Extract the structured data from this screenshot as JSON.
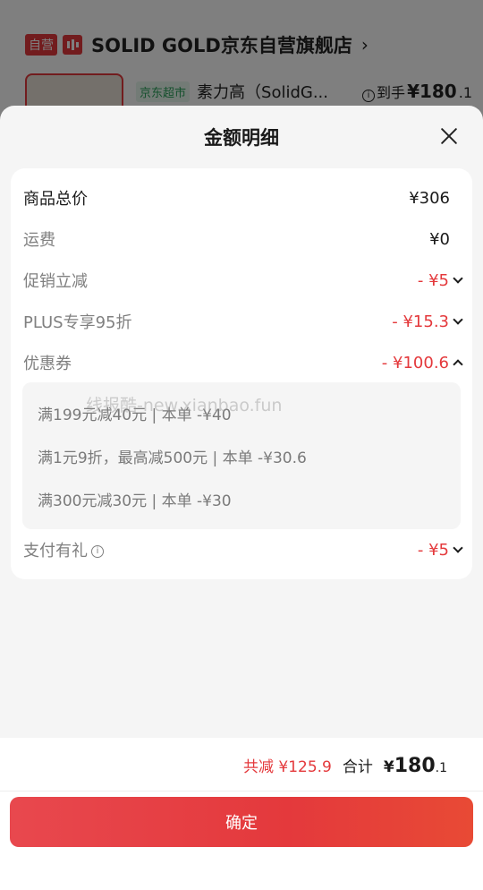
{
  "background": {
    "store_tag": "自营",
    "store_name": "SOLID GOLD京东自营旗舰店",
    "store_chevron": "›",
    "jd_mart": "京东超市",
    "product_name": "素力高（SolidG...",
    "arrive_label": "到手",
    "arrive_price_main": "¥180",
    "arrive_price_dec": ".1"
  },
  "sheet": {
    "title": "金额明细"
  },
  "rows": [
    {
      "label": "商品总价",
      "value": "¥306"
    },
    {
      "label": "运费",
      "value": "¥0"
    },
    {
      "label": "促销立减",
      "value": "- ¥5"
    },
    {
      "label": "PLUS专享95折",
      "value": "- ¥15.3"
    },
    {
      "label": "优惠券",
      "value": "- ¥100.6"
    },
    {
      "label": "支付有礼",
      "value": "- ¥5"
    }
  ],
  "coupons": [
    "满199元减40元 | 本单 -¥40",
    "满1元9折，最高减500元 | 本单 -¥30.6",
    "满300元减30元 | 本单 -¥30"
  ],
  "watermark": "线报酷-new.xianbao.fun",
  "footer": {
    "saved": "共减 ¥125.9",
    "total_label": "合计",
    "total_currency": "¥",
    "total_main": "180",
    "total_dec": ".1",
    "confirm": "确定"
  },
  "colors": {
    "accent_red": "#e4393c",
    "muted_text": "#808080"
  }
}
